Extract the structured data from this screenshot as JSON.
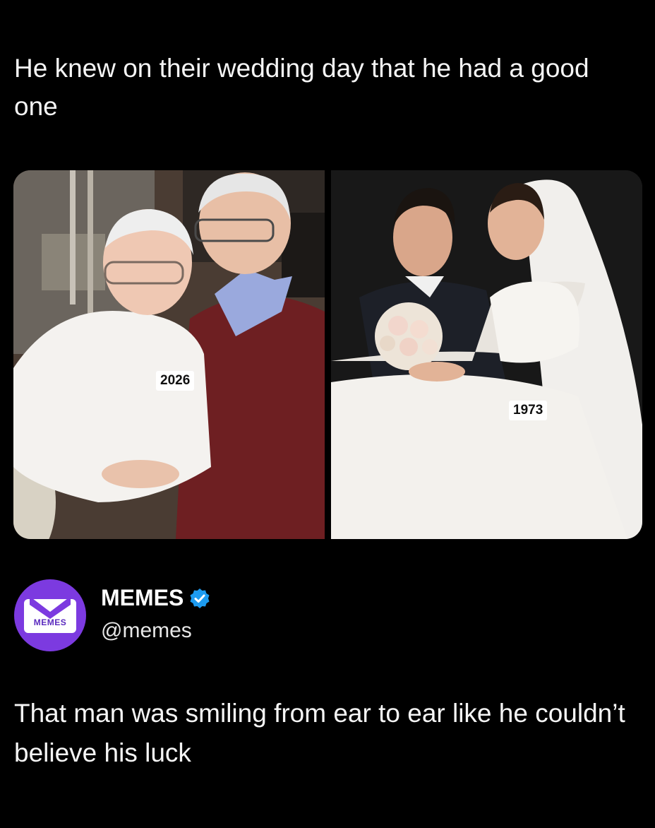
{
  "post": {
    "text": "He knew on their wedding day that he had a good one"
  },
  "media": {
    "left_photo": {
      "year_label": "2026"
    },
    "right_photo": {
      "year_label": "1973"
    }
  },
  "quoted": {
    "avatar_label": "MEMES",
    "display_name": "MEMES",
    "handle": "@memes",
    "verified_icon": "verified-badge-icon",
    "text": "That man was smiling from ear to ear like he couldn’t believe his luck"
  },
  "colors": {
    "background": "#000000",
    "text": "#f5f5f5",
    "avatar_purple": "#7c3ae0",
    "verified_blue": "#1d9bf0"
  }
}
